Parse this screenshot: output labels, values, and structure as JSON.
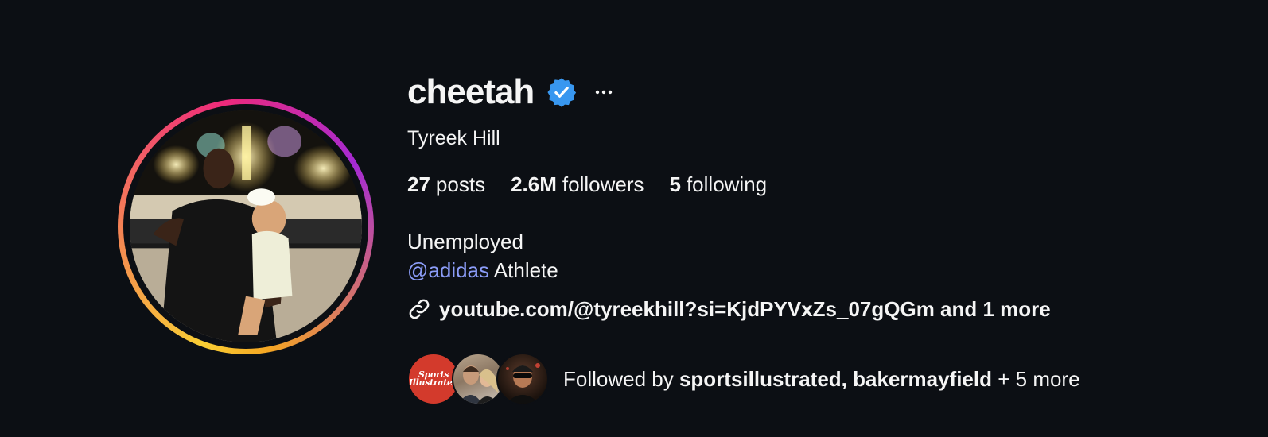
{
  "profile": {
    "username": "cheetah",
    "full_name": "Tyreek Hill",
    "verified": true,
    "stats": [
      {
        "value": "27",
        "label": "posts"
      },
      {
        "value": "2.6M",
        "label": "followers"
      },
      {
        "value": "5",
        "label": "following"
      }
    ],
    "bio": {
      "line1": "Unemployed",
      "mention": "@adidas",
      "line2_rest": " Athlete"
    },
    "link": "youtube.com/@tyreekhill?si=KjdPYVxZs_07gQGm and 1 more",
    "followed_by": {
      "prefix": "Followed by ",
      "names": "sportsillustrated, bakermayfield",
      "suffix": " + 5 more",
      "avatar_si_text": "Sports Illustrated"
    }
  },
  "icons": {
    "verified": "verified-badge-icon",
    "more": "more-options-icon",
    "link": "link-icon"
  },
  "colors": {
    "background": "#0c0f14",
    "verified": "#3897f0",
    "mention": "#8b9cf7",
    "text": "#f5f5f5"
  }
}
